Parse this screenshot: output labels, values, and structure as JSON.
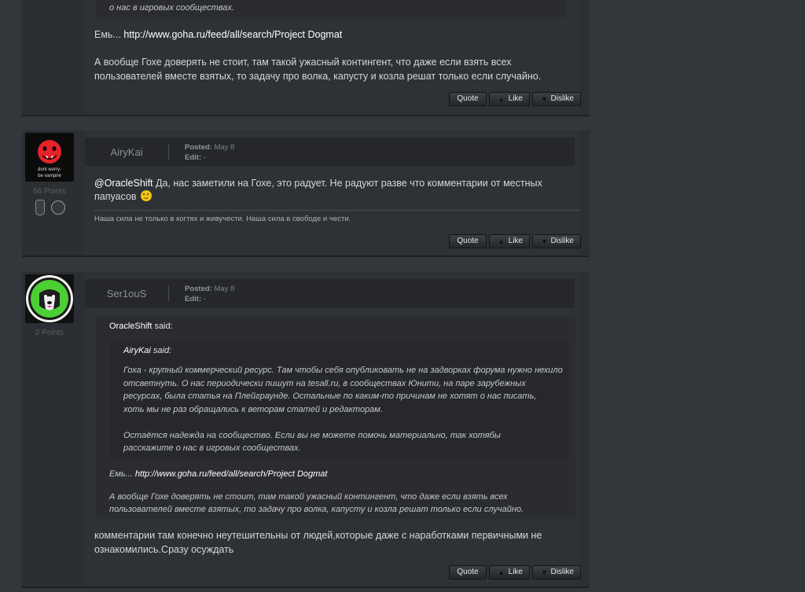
{
  "buttons": {
    "quote": "Quote",
    "like": "Like",
    "dislike": "Dislike"
  },
  "post0": {
    "quote_tail": "о нас в игровых сообществах.",
    "line1_prefix": "Емь... ",
    "line1_link": "http://www.goha.ru/feed/all/search/Project Dogmat",
    "line2": "А вообще Гохе доверять не стоит, там такой ужасный контингент, что даже если взять всех",
    "line3": "пользователей вместе взятых, то задачу про волка, капусту и козла решат только если случайно."
  },
  "post1": {
    "username": "AiryKai",
    "posted_label": "Posted:",
    "posted_value": "May 8",
    "edit_label": "Edit:",
    "edit_value": "-",
    "points": "66 Points",
    "avatar_caption_1": "dont worry-",
    "avatar_caption_2": "be vampire",
    "mention": "@OracleShift",
    "line1": " Да, нас заметили на Гохе, это радует. Не радуют разве что комментарии от местных",
    "line2": "папуасов",
    "signature": "Наша сила не только в когтях и живучести. Наша сила в свободе и чести."
  },
  "post2": {
    "username": "Ser1ouS",
    "posted_label": "Posted:",
    "posted_value": "May 8",
    "edit_label": "Edit:",
    "edit_value": "-",
    "points": "2 Points",
    "outer_quote_author": "OracleShift",
    "said": " said:",
    "inner_quote_author": "AiryKai",
    "inner_lines": [
      "Гоха - крупный коммерческий ресурс. Там чтобы себя опубликовать не на задворках форума нужно нехило",
      "отсветнуть. О нас периодически пишут на tesall.ru, в сообществах Юнити, на паре зарубежных",
      "ресурсах, была статья на Плейграунде. Остальные по каким-то причинам не хотят о нас писать,",
      "хоть мы не раз обращались к веторам статей и редакторам.",
      "",
      "Остаётся надежда на сообщество. Если вы не можете помочь материально, так хотябы",
      "расскажите о нас в игровых сообществах."
    ],
    "outer_line1_prefix": "Емь... ",
    "outer_line1_link": "http://www.goha.ru/feed/all/search/Project Dogmat",
    "outer_line2": "А вообще Гохе доверять не стоит, там такой ужасный контингент, что даже если взять всех",
    "outer_line3": "пользователей вместе взятых, то задачу про волка, капусту и козла решат только если случайно.",
    "reply_line1": "комментарии там конечно неутешительны от людей,которые даже с наработками первичными не",
    "reply_line2": "ознакомились.Сразу осуждать"
  },
  "colors": {
    "page_bg": "#33363b",
    "post_bg": "#2b2e32",
    "header_bg": "#25272b",
    "link": "#ffffff"
  }
}
